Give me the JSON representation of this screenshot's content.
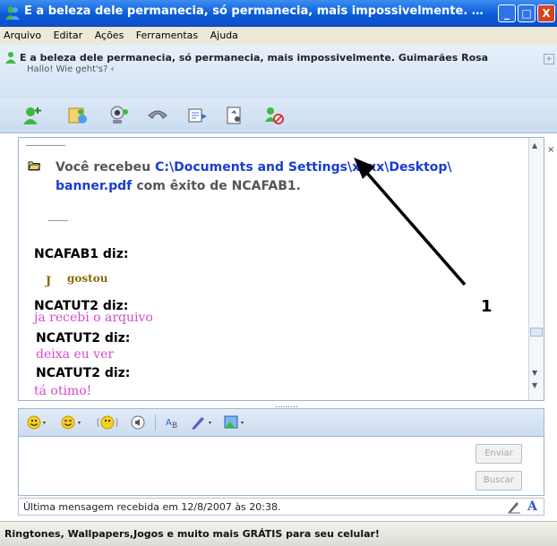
{
  "window": {
    "title": "E a beleza dele permanecia, só permanecia, mais impossivelmente. Guimarã...",
    "buttons": {
      "minimize": "_",
      "maximize": "□",
      "close": "X"
    }
  },
  "menu": [
    "Arquivo",
    "Editar",
    "Ações",
    "Ferramentas",
    "Ajuda"
  ],
  "contact": {
    "name": "E a beleza dele permanecia, só permanecia, mais impossivelmente. Guimarães Rosa",
    "status": "Hallo! Wie geht's? ‹"
  },
  "toolbar_icons": [
    "invite-contact-icon",
    "send-files-icon",
    "webcam-icon",
    "voice-call-icon",
    "activities-icon",
    "games-icon",
    "block-icon"
  ],
  "conversation": {
    "file_line": {
      "prefix": "Você recebeu",
      "path": "C:\\Documents and Settings\\xxxx\\Desktop\\",
      "file": "banner.pdf",
      "suffix": "com êxito de NCAFAB1."
    },
    "messages": [
      {
        "sender": "NCAFAB1 diz:",
        "text": "gostou",
        "emoticon": "J"
      },
      {
        "sender": "NCATUT2 diz:",
        "text": "ja recebi o arquivo"
      },
      {
        "sender": "NCATUT2 diz:",
        "text": "deixa eu ver"
      },
      {
        "sender": "NCATUT2 diz:",
        "text": "tá otimo!"
      }
    ]
  },
  "annotation": {
    "label": "1"
  },
  "compose": {
    "send_label": "Enviar",
    "search_label": "Buscar",
    "grip": "........."
  },
  "status_bar": {
    "text": "Última mensagem recebida em 12/8/2007 às 20:38."
  },
  "ad_bar": {
    "text": "Ringtones, Wallpapers,Jogos e muito mais GRÁTIS para seu celular!"
  },
  "colors": {
    "title_blue": "#0a5bd8",
    "link_blue": "#1a3cd8",
    "message_pink": "#d94ad0",
    "close_red": "#d9431f"
  }
}
